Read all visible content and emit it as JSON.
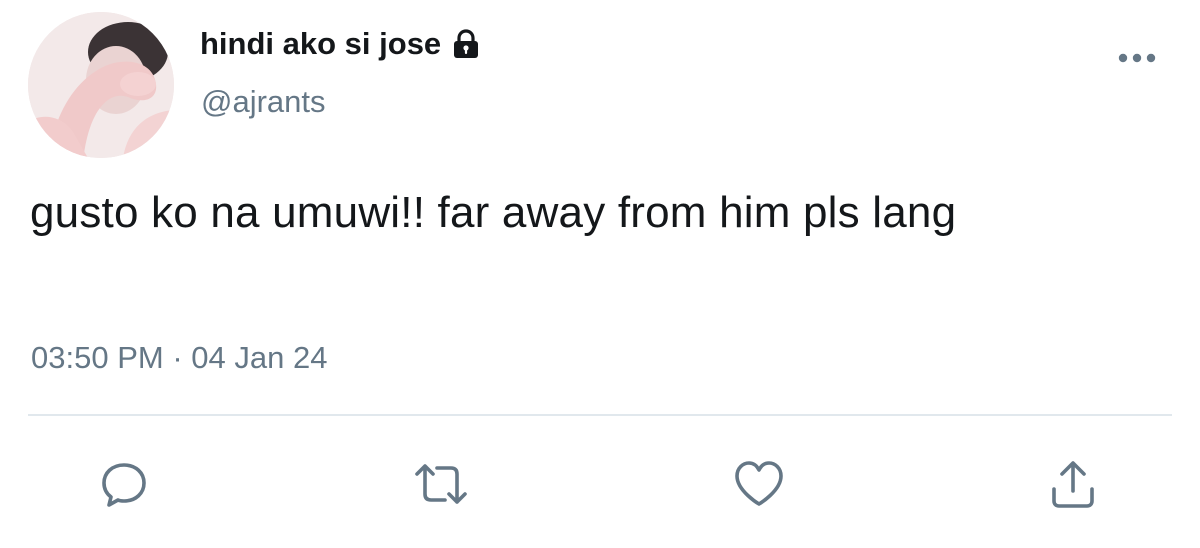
{
  "tweet": {
    "display_name": "hindi ako si jose",
    "protected_icon": "lock-icon",
    "handle": "@ajrants",
    "text": "gusto ko na umuwi!! far away from him pls lang",
    "time": "03:50 PM",
    "separator": "·",
    "date": "04 Jan 24"
  },
  "icons": {
    "more": "more-horizontal-icon",
    "reply": "reply-icon",
    "retweet": "retweet-icon",
    "like": "heart-icon",
    "share": "share-icon"
  },
  "colors": {
    "text": "#14171a",
    "secondary": "#657786",
    "divider": "#e1e8ed",
    "avatar_bg": "#efe4e4"
  }
}
